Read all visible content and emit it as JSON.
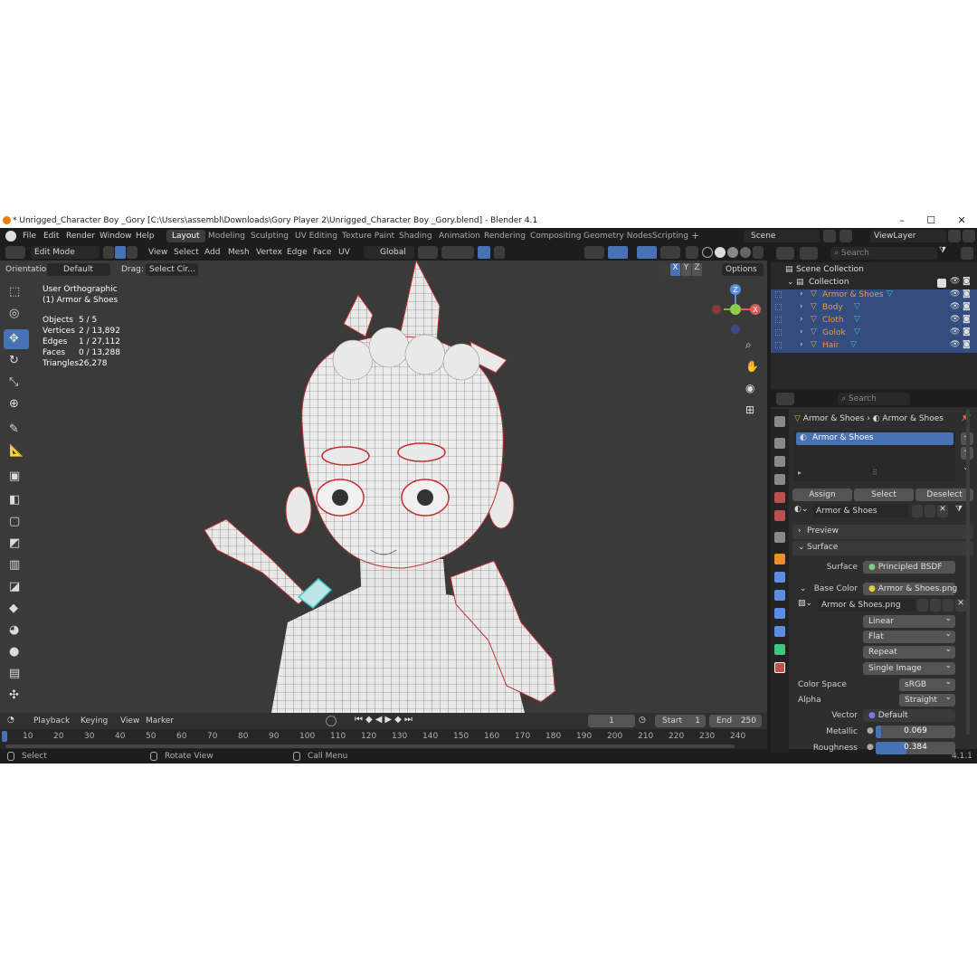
{
  "window": {
    "title": "* Unrigged_Character Boy _Gory [C:\\Users\\assembl\\Downloads\\Gory Player 2\\Unrigged_Character Boy _Gory.blend] - Blender 4.1",
    "minimize": "–",
    "maximize": "☐",
    "close": "✕"
  },
  "menubar": {
    "items": [
      "File",
      "Edit",
      "Render",
      "Window",
      "Help"
    ],
    "workspaces": [
      "Layout",
      "Modeling",
      "Sculpting",
      "UV Editing",
      "Texture Paint",
      "Shading",
      "Animation",
      "Rendering",
      "Compositing",
      "Geometry Nodes",
      "Scripting"
    ],
    "add_tab": "+",
    "scene": "Scene",
    "view_layer": "ViewLayer"
  },
  "viewport": {
    "mode": "Edit Mode",
    "menus": [
      "View",
      "Select",
      "Add",
      "Mesh",
      "Vertex",
      "Edge",
      "Face",
      "UV"
    ],
    "transform": "Global",
    "orientation_label": "Orientation:",
    "orientation": "Default",
    "drag_label": "Drag:",
    "drag": "Select Cir...",
    "options": "Options",
    "axes": [
      "X",
      "Y",
      "Z"
    ],
    "view_name": "User Orthographic",
    "object_name": "(1) Armor & Shoes",
    "stats": [
      {
        "k": "Objects",
        "v": "5 / 5"
      },
      {
        "k": "Vertices",
        "v": "2 / 13,892"
      },
      {
        "k": "Edges",
        "v": "1 / 27,112"
      },
      {
        "k": "Faces",
        "v": "0 / 13,288"
      },
      {
        "k": "Triangles",
        "v": "26,278"
      }
    ],
    "gizmo": {
      "z": "Z",
      "x": "X"
    }
  },
  "timeline": {
    "menus": [
      "Playback",
      "Keying",
      "View",
      "Marker"
    ],
    "current_frame": "1",
    "start_label": "Start",
    "start": "1",
    "end_label": "End",
    "end": "250",
    "ticks": [
      "10",
      "20",
      "30",
      "40",
      "50",
      "60",
      "70",
      "80",
      "90",
      "100",
      "110",
      "120",
      "130",
      "140",
      "150",
      "160",
      "170",
      "180",
      "190",
      "200",
      "210",
      "220",
      "230",
      "240"
    ]
  },
  "statusbar": {
    "select": "Select",
    "rotate": "Rotate View",
    "call_menu": "Call Menu",
    "version": "4.1.1"
  },
  "outliner": {
    "search_placeholder": "Search",
    "root": "Scene Collection",
    "collection": "Collection",
    "items": [
      "Armor & Shoes",
      "Body",
      "Cloth",
      "Golok",
      "Hair"
    ]
  },
  "properties": {
    "search_placeholder": "Search",
    "breadcrumb_object": "Armor & Shoes",
    "breadcrumb_material": "Armor & Shoes",
    "slot": "Armor & Shoes",
    "assign": "Assign",
    "select": "Select",
    "deselect": "Deselect",
    "material_name": "Armor & Shoes",
    "preview": "Preview",
    "surface_panel": "Surface",
    "surface_label": "Surface",
    "surface_value": "Principled BSDF",
    "base_color_label": "Base Color",
    "base_color_value": "Armor & Shoes.png",
    "image_name": "Armor & Shoes.png",
    "interpolation": "Linear",
    "projection": "Flat",
    "extension": "Repeat",
    "source": "Single Image",
    "color_space_label": "Color Space",
    "color_space": "sRGB",
    "alpha_label": "Alpha",
    "alpha": "Straight",
    "vector_label": "Vector",
    "vector": "Default",
    "metallic_label": "Metallic",
    "metallic": "0.069",
    "metallic_level": 0.069,
    "roughness_label": "Roughness",
    "roughness": "0.384",
    "roughness_level": 0.384
  },
  "colors": {
    "accent": "#4772b3",
    "selection": "#334d80",
    "object_orange": "#e89a3c",
    "background": "#3a3a3a"
  }
}
